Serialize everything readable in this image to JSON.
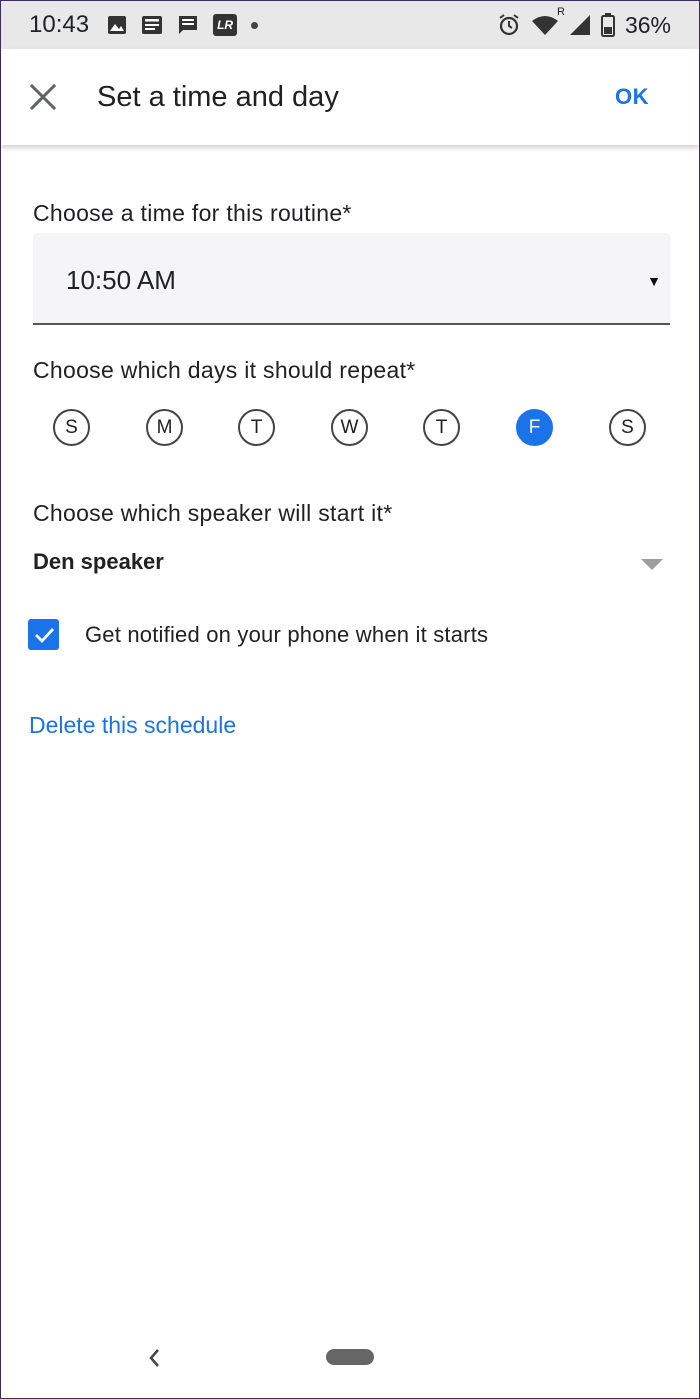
{
  "status_bar": {
    "time": "10:43",
    "left_icons": [
      "image-icon",
      "news-icon",
      "message-icon",
      "lr-app-icon",
      "dot-icon"
    ],
    "lr_label": "LR",
    "right_icons": [
      "alarm-icon",
      "wifi-icon",
      "signal-icon",
      "battery-icon"
    ],
    "roaming_label": "R",
    "battery_percent": "36%"
  },
  "app_bar": {
    "close_icon": "close-icon",
    "title": "Set a time and day",
    "ok_label": "OK"
  },
  "time_section": {
    "label": "Choose a time for this routine*",
    "value": "10:50 AM",
    "arrow": "▾"
  },
  "days_section": {
    "label": "Choose which days it should repeat*",
    "days": [
      {
        "letter": "S",
        "selected": false
      },
      {
        "letter": "M",
        "selected": false
      },
      {
        "letter": "T",
        "selected": false
      },
      {
        "letter": "W",
        "selected": false
      },
      {
        "letter": "T",
        "selected": false
      },
      {
        "letter": "F",
        "selected": true
      },
      {
        "letter": "S",
        "selected": false
      }
    ]
  },
  "speaker_section": {
    "label": "Choose which speaker will start it*",
    "value": "Den speaker"
  },
  "notify": {
    "checked": true,
    "label": "Get notified on your phone when it starts"
  },
  "delete_link": "Delete this schedule",
  "colors": {
    "accent": "#1a73e8",
    "status_bar_bg": "#e8e8e8",
    "field_bg": "#f5f5f7"
  }
}
